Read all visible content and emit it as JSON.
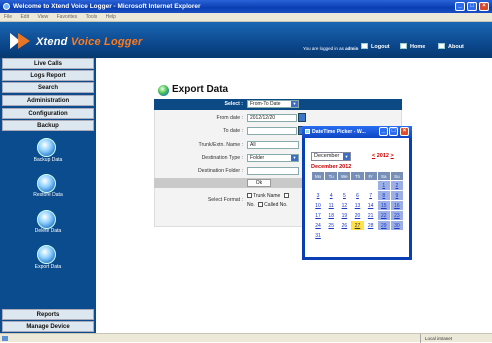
{
  "window": {
    "title": "Welcome to Xtend Voice Logger - Microsoft Internet Explorer"
  },
  "menu": [
    "File",
    "Edit",
    "View",
    "Favorites",
    "Tools",
    "Help"
  ],
  "header": {
    "logo_word1": "Xtend",
    "logo_word2": "Voice Logger",
    "logged_prefix": "You are logged in as",
    "user": "admin",
    "logout": "Logout",
    "home": "Home",
    "about": "About"
  },
  "sidebar": {
    "items": [
      "Live Calls",
      "Logs Report",
      "Search",
      "Administration",
      "Configuration",
      "Backup"
    ],
    "backup_items": [
      "Backup Data",
      "Restore Data",
      "Delete Data",
      "Export Data"
    ],
    "bottom_items": [
      "Reports",
      "Manage Device"
    ]
  },
  "page": {
    "title": "Export Data",
    "select_label": "Select :",
    "select_value": "From-To Date",
    "from_label": "From date :",
    "from_value": "2012/12/20",
    "to_label": "To date :",
    "to_value": "",
    "trunk_label": "Trunk/Extn. Name :",
    "trunk_value": "All",
    "dest_type_label": "Destination Type :",
    "dest_type_value": "Folder",
    "dest_folder_label": "Destination Folder :",
    "dest_folder_value": "",
    "ok": "Ok",
    "format_label": "Select Format :",
    "format_opt1": "Trunk Name",
    "format_opt1b": "No.",
    "format_opt2": "Called No."
  },
  "picker": {
    "title": "DateTime Picker - W...",
    "month": "December",
    "year_prev": "<",
    "year": "2012",
    "year_next": ">",
    "heading": "December 2012",
    "days": [
      "Mo",
      "Tu",
      "We",
      "Th",
      "Fr",
      "Sa",
      "Su"
    ],
    "weeks": [
      [
        "",
        "",
        "",
        "",
        "",
        "1",
        "2"
      ],
      [
        "3",
        "4",
        "5",
        "6",
        "7",
        "8",
        "9"
      ],
      [
        "10",
        "11",
        "12",
        "13",
        "14",
        "15",
        "16"
      ],
      [
        "17",
        "18",
        "19",
        "20",
        "21",
        "22",
        "23"
      ],
      [
        "24",
        "25",
        "26",
        "27",
        "28",
        "29",
        "30"
      ],
      [
        "31",
        "",
        "",
        "",
        "",
        "",
        ""
      ]
    ],
    "today": "27"
  },
  "status": {
    "zone": "Local intranet"
  }
}
